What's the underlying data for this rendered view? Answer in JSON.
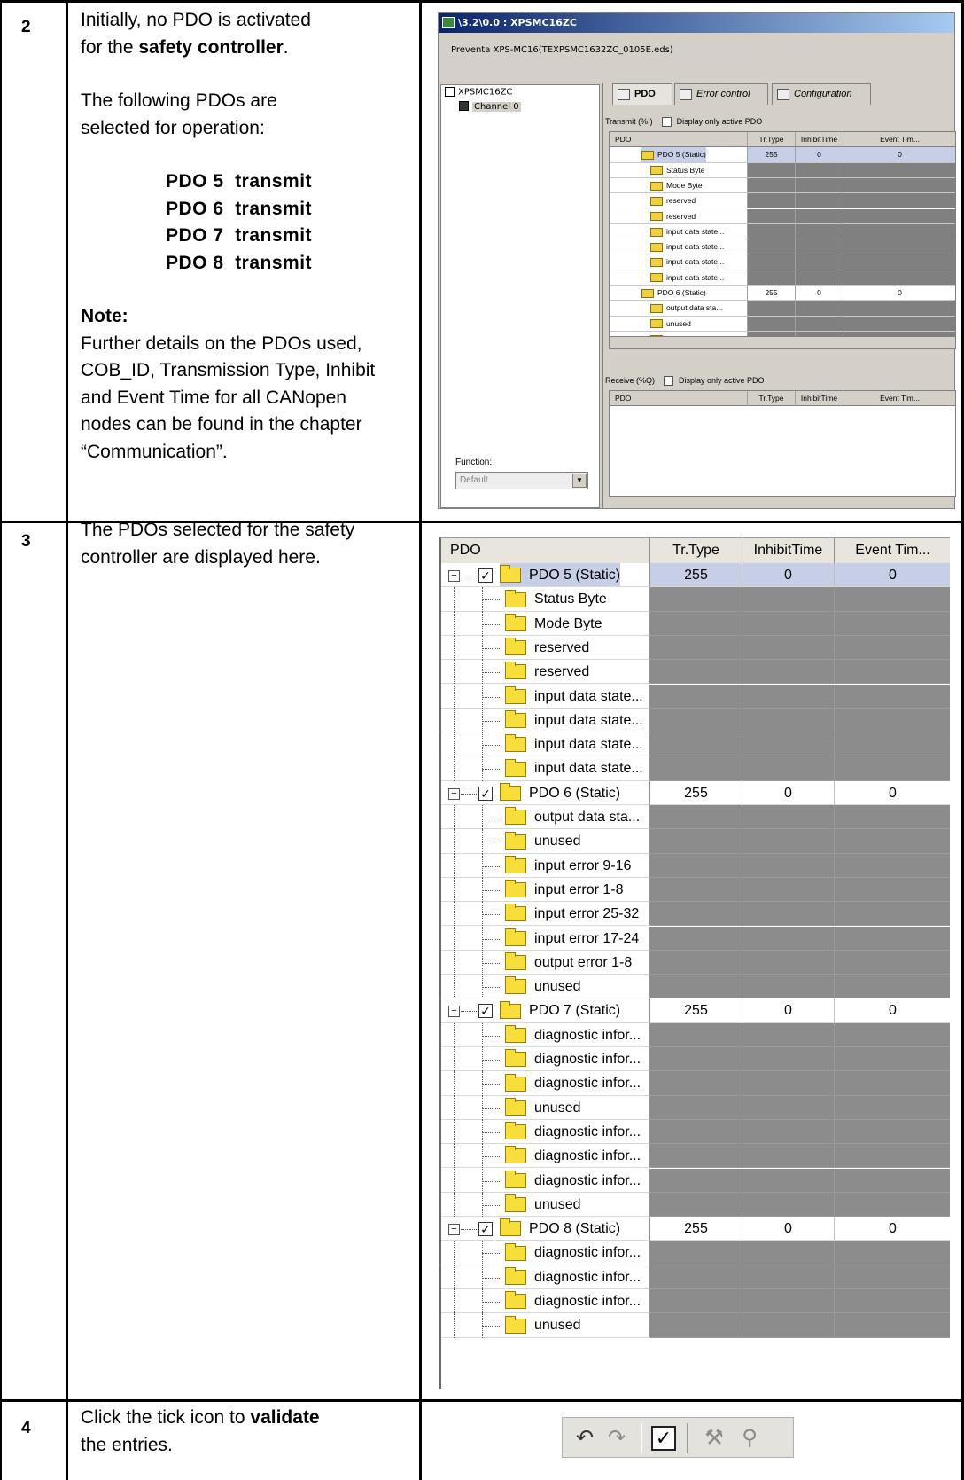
{
  "steps": [
    {
      "number": "2"
    },
    {
      "number": "3",
      "text": "The PDOs selected for the safety controller are displayed here."
    },
    {
      "number": "4"
    }
  ],
  "step2": {
    "line1": "Initially, no PDO is activated",
    "line2_pre": "for the ",
    "line2_bold": "safety controller",
    "line2_post": ".",
    "para2": "The following PDOs are selected for operation:",
    "pdos": [
      "PDO 5  transmit",
      "PDO 6  transmit",
      "PDO 7  transmit",
      "PDO 8  transmit"
    ],
    "note_title": "Note:",
    "note_text": "Further details on the PDOs used, COB_ID, Transmission Type, Inhibit and Event Time for all CANopen nodes can be found in the chapter “Communication”."
  },
  "step4": {
    "pre": "Click the tick icon to ",
    "bold": "validate",
    "post": "the entries."
  },
  "window": {
    "title": "\\3.2\\0.0 : XPSMC16ZC",
    "subtitle": "Preventa XPS-MC16(TEXPSMC1632ZC_0105E.eds)",
    "tree_root": "XPSMC16ZC",
    "tree_child": "Channel 0",
    "function_label": "Function:",
    "function_value": "Default",
    "tabs": [
      "PDO",
      "Error control",
      "Configuration"
    ],
    "transmit_label": "Transmit (%I)",
    "receive_label": "Receive (%Q)",
    "display_active_label": "Display only active PDO",
    "columns": [
      "PDO",
      "Tr.Type",
      "InhibitTime",
      "Event Tim..."
    ],
    "rows": [
      {
        "name": "PDO 5 (Static)",
        "group": true,
        "tr": "255",
        "inh": "0",
        "evt": "0"
      },
      {
        "name": "Status Byte"
      },
      {
        "name": "Mode Byte"
      },
      {
        "name": "reserved"
      },
      {
        "name": "reserved"
      },
      {
        "name": "input data state..."
      },
      {
        "name": "input data state..."
      },
      {
        "name": "input data state..."
      },
      {
        "name": "input data state..."
      },
      {
        "name": "PDO 6 (Static)",
        "group": true,
        "tr": "255",
        "inh": "0",
        "evt": "0"
      },
      {
        "name": "output data sta..."
      },
      {
        "name": "unused"
      },
      {
        "name": "input error 9-16"
      }
    ]
  },
  "grid": {
    "columns": [
      "PDO",
      "Tr.Type",
      "InhibitTime",
      "Event Tim..."
    ],
    "rows": [
      {
        "name": "PDO 5 (Static)",
        "group": true,
        "tr": "255",
        "inh": "0",
        "evt": "0"
      },
      {
        "name": "Status Byte"
      },
      {
        "name": "Mode Byte"
      },
      {
        "name": "reserved"
      },
      {
        "name": "reserved"
      },
      {
        "name": "input data state..."
      },
      {
        "name": "input data state..."
      },
      {
        "name": "input data state..."
      },
      {
        "name": "input data state..."
      },
      {
        "name": "PDO 6 (Static)",
        "group": true,
        "tr": "255",
        "inh": "0",
        "evt": "0"
      },
      {
        "name": "output data sta..."
      },
      {
        "name": "unused"
      },
      {
        "name": "input error 9-16"
      },
      {
        "name": "input error 1-8"
      },
      {
        "name": "input error 25-32"
      },
      {
        "name": "input error 17-24"
      },
      {
        "name": "output error 1-8"
      },
      {
        "name": "unused"
      },
      {
        "name": "PDO 7 (Static)",
        "group": true,
        "tr": "255",
        "inh": "0",
        "evt": "0"
      },
      {
        "name": "diagnostic infor..."
      },
      {
        "name": "diagnostic infor..."
      },
      {
        "name": "diagnostic infor..."
      },
      {
        "name": "unused"
      },
      {
        "name": "diagnostic infor..."
      },
      {
        "name": "diagnostic infor..."
      },
      {
        "name": "diagnostic infor..."
      },
      {
        "name": "unused"
      },
      {
        "name": "PDO 8 (Static)",
        "group": true,
        "tr": "255",
        "inh": "0",
        "evt": "0"
      },
      {
        "name": "diagnostic infor..."
      },
      {
        "name": "diagnostic infor..."
      },
      {
        "name": "diagnostic infor..."
      },
      {
        "name": "unused"
      }
    ]
  },
  "toolbar": {
    "icons": [
      "undo-icon",
      "redo-icon",
      "validate-check-icon",
      "build-icon",
      "search-icon"
    ]
  },
  "colors": {
    "selected_row": "#c7cfe6",
    "disabled_cell": "#8c8c8c",
    "folder": "#f7de3a",
    "title_bar": "#0a246a"
  }
}
